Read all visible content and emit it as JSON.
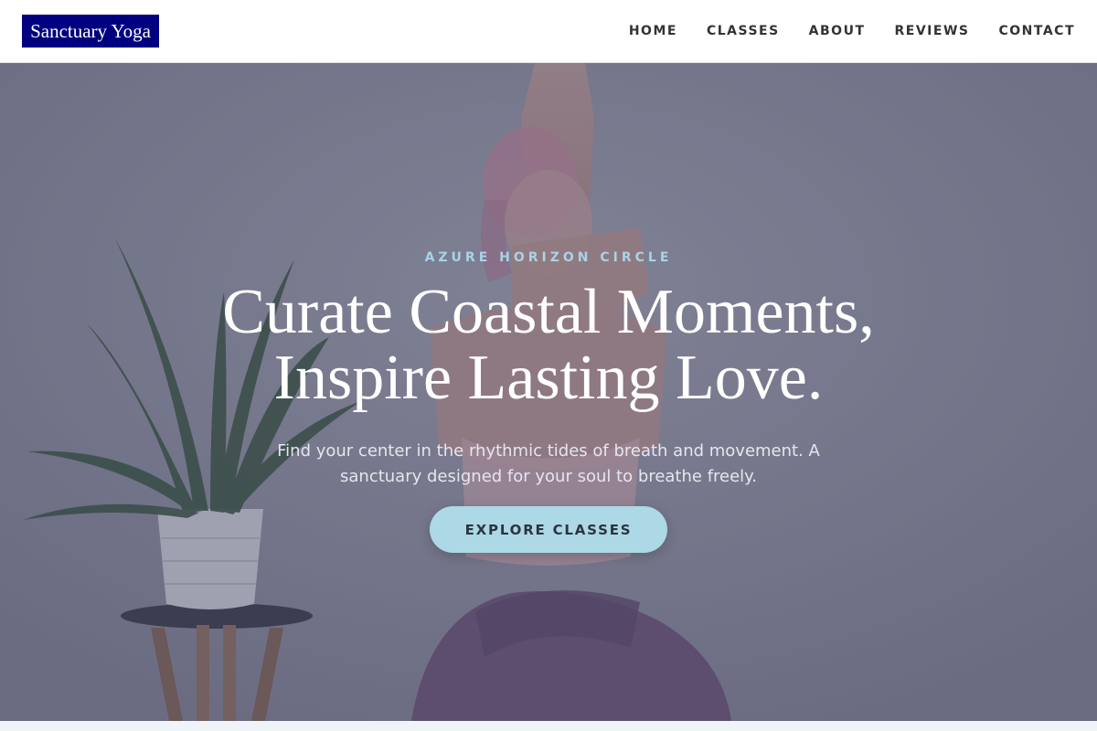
{
  "brand": {
    "name": "Sanctuary Yoga"
  },
  "nav": {
    "items": [
      {
        "label": "HOME"
      },
      {
        "label": "CLASSES"
      },
      {
        "label": "ABOUT"
      },
      {
        "label": "REVIEWS"
      },
      {
        "label": "CONTACT"
      }
    ]
  },
  "hero": {
    "eyebrow": "AZURE HORIZON CIRCLE",
    "title_line1": "Curate Coastal Moments,",
    "title_line2": "Inspire Lasting Love.",
    "subtitle": "Find your center in the rhythmic tides of breath and movement. A sanctuary designed for your soul to breathe freely.",
    "cta_label": "EXPLORE CLASSES",
    "image_icon": "yoga-pose-photo"
  },
  "colors": {
    "brand": "#000080",
    "accent": "#add8e6",
    "eyebrow": "#a9d3e6"
  }
}
